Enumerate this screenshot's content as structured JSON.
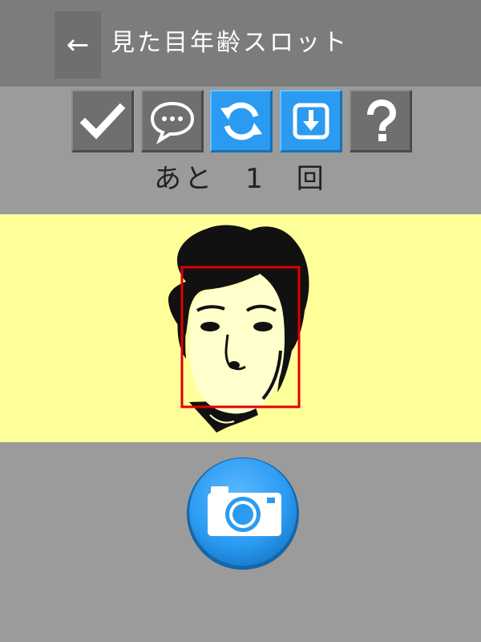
{
  "header": {
    "back_label": "←",
    "title": "見た目年齢スロット"
  },
  "toolbar": {
    "buttons": [
      {
        "name": "confirm",
        "icon": "check-icon",
        "style": "gray"
      },
      {
        "name": "comment",
        "icon": "speech-bubble-icon",
        "style": "gray"
      },
      {
        "name": "refresh",
        "icon": "refresh-icon",
        "style": "blue"
      },
      {
        "name": "save",
        "icon": "download-icon",
        "style": "blue"
      },
      {
        "name": "help",
        "icon": "question-icon",
        "style": "gray"
      }
    ]
  },
  "remaining": {
    "text": "あと　1　回"
  },
  "photo": {
    "subject": "face-illustration",
    "face_box_color": "#e00000",
    "background_color": "#ffff99"
  },
  "camera": {
    "icon": "camera-icon",
    "color": "#2b9bf2"
  },
  "colors": {
    "header_bg": "#7c7c7c",
    "page_bg": "#9b9b9b",
    "accent_blue": "#2b9bf2"
  }
}
